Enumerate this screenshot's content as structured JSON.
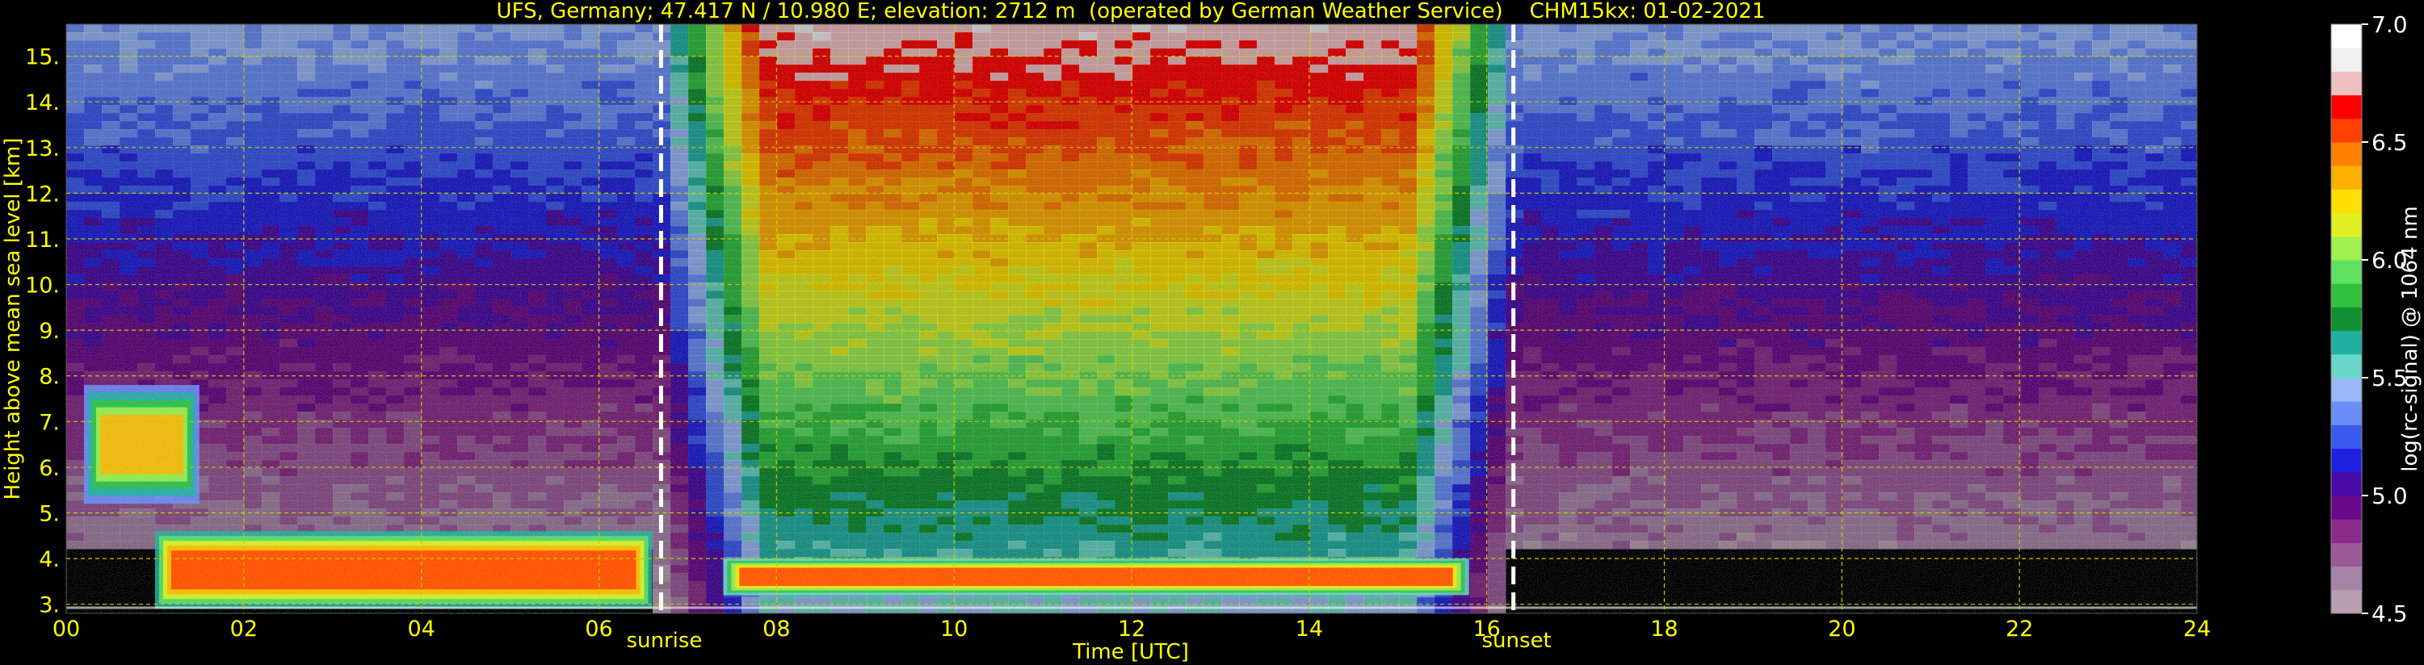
{
  "chart_data": {
    "type": "heatmap",
    "title": "UFS, Germany; 47.417 N / 10.980 E; elevation: 2712 m  (operated by German Weather Service)    CHM15kx: 01-02-2021",
    "xlabel": "Time [UTC]",
    "ylabel": "Height above mean sea level [km]",
    "xlim": [
      0,
      24
    ],
    "ylim": [
      2.8,
      15.7
    ],
    "x_ticks": [
      0,
      2,
      4,
      6,
      8,
      10,
      12,
      14,
      16,
      18,
      20,
      22,
      24
    ],
    "x_tick_labels": [
      "00",
      "02",
      "04",
      "06",
      "08",
      "10",
      "12",
      "14",
      "16",
      "18",
      "20",
      "22",
      "24"
    ],
    "y_ticks": [
      3,
      4,
      5,
      6,
      7,
      8,
      9,
      10,
      11,
      12,
      13,
      14,
      15
    ],
    "y_tick_labels": [
      "3.",
      "4.",
      "5.",
      "6.",
      "7.",
      "8.",
      "9.",
      "10.",
      "11.",
      "12.",
      "13.",
      "14.",
      "15."
    ],
    "grid": true,
    "events": [
      {
        "label": "sunrise",
        "x": 6.7
      },
      {
        "label": "sunset",
        "x": 16.3
      }
    ],
    "layers": [
      {
        "x_start": 7.4,
        "x_end": 15.8,
        "y_bottom": 3.2,
        "y_top": 4.0,
        "peak": 6.5
      },
      {
        "x_start": 0.2,
        "x_end": 1.5,
        "y_bottom": 5.2,
        "y_top": 7.8,
        "peak": 6.3
      },
      {
        "x_start": 1.0,
        "x_end": 6.6,
        "y_bottom": 2.9,
        "y_top": 4.6,
        "peak": 6.6
      }
    ],
    "colorbar": {
      "label": "log(rc-signal) @ 1064 nm",
      "range": [
        4.5,
        7.0
      ],
      "ticks": [
        4.5,
        5.0,
        5.5,
        6.0,
        6.5,
        7.0
      ],
      "tick_labels": [
        "4.5",
        "5.0",
        "5.5",
        "6.0",
        "6.5",
        "7.0"
      ],
      "colors": [
        "#b8a0b0",
        "#a584a8",
        "#9a5a9a",
        "#8a2a8a",
        "#6a0a8a",
        "#4a0aa8",
        "#2020e0",
        "#3a5af0",
        "#6a8ef8",
        "#9ab8f8",
        "#6ad8c8",
        "#20b0a0",
        "#109030",
        "#30c040",
        "#60e060",
        "#a0f050",
        "#e0f020",
        "#ffe000",
        "#ffb000",
        "#ff8000",
        "#ff4000",
        "#ff0000",
        "#f0c0c0",
        "#f0f0f0",
        "#ffffff"
      ]
    }
  },
  "style": {
    "background": "#000000",
    "axis_text_color": "#ffff00",
    "colorbar_text_color": "#ffffff",
    "grid_color": "#c8c800",
    "marker_color": "#ffffff"
  }
}
